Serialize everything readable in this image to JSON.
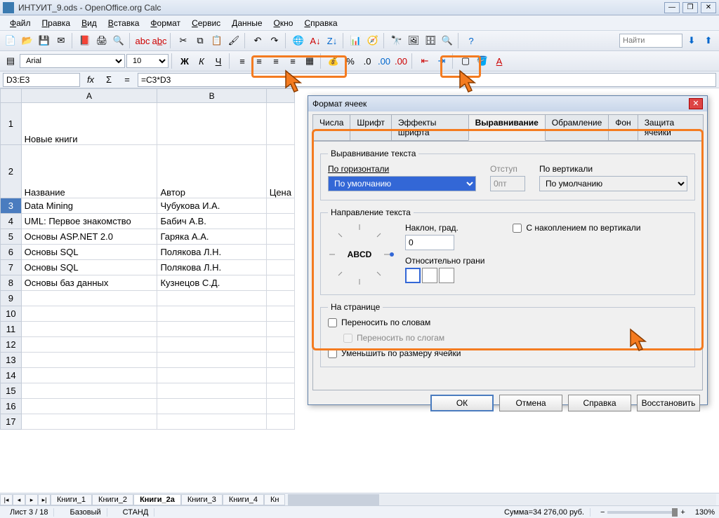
{
  "window": {
    "title": "ИНТУИТ_9.ods - OpenOffice.org Calc"
  },
  "menu": [
    "Файл",
    "Правка",
    "Вид",
    "Вставка",
    "Формат",
    "Сервис",
    "Данные",
    "Окно",
    "Справка"
  ],
  "toolbar2": {
    "font": "Arial",
    "size": "10",
    "search_placeholder": "Найти"
  },
  "formulabar": {
    "cellref": "D3:E3",
    "formula": "=C3*D3"
  },
  "columns": [
    "A",
    "B"
  ],
  "colC_hdr": "Цена",
  "rows": [
    {
      "n": "1",
      "a": "Новые книги",
      "b": "",
      "cls": "tall1"
    },
    {
      "n": "2",
      "a": "Название",
      "b": "Автор",
      "cls": "tall2"
    },
    {
      "n": "3",
      "a": "Data Mining",
      "b": "Чубукова И.А.",
      "sel": true
    },
    {
      "n": "4",
      "a": "UML: Первое знакомство",
      "b": "Бабич А.В."
    },
    {
      "n": "5",
      "a": "Основы ASP.NET 2.0",
      "b": "Гаряка А.А."
    },
    {
      "n": "6",
      "a": "Основы SQL",
      "b": "Полякова Л.Н."
    },
    {
      "n": "7",
      "a": "Основы SQL",
      "b": "Полякова Л.Н."
    },
    {
      "n": "8",
      "a": "Основы баз данных",
      "b": "Кузнецов С.Д."
    },
    {
      "n": "9",
      "a": "",
      "b": ""
    },
    {
      "n": "10",
      "a": "",
      "b": ""
    },
    {
      "n": "11",
      "a": "",
      "b": ""
    },
    {
      "n": "12",
      "a": "",
      "b": ""
    },
    {
      "n": "13",
      "a": "",
      "b": ""
    },
    {
      "n": "14",
      "a": "",
      "b": ""
    },
    {
      "n": "15",
      "a": "",
      "b": ""
    },
    {
      "n": "16",
      "a": "",
      "b": ""
    },
    {
      "n": "17",
      "a": "",
      "b": ""
    }
  ],
  "sheettabs": [
    "Книги_1",
    "Книги_2",
    "Книги_2а",
    "Книги_3",
    "Книги_4",
    "Кн"
  ],
  "active_tab": 2,
  "dialog": {
    "title": "Формат ячеек",
    "tabs": [
      "Числа",
      "Шрифт",
      "Эффекты шрифта",
      "Выравнивание",
      "Обрамление",
      "Фон",
      "Защита ячейки"
    ],
    "active_tab": 3,
    "align": {
      "group": "Выравнивание текста",
      "h_label": "По горизонтали",
      "h_value": "По умолчанию",
      "indent_label": "Отступ",
      "indent_value": "0пт",
      "v_label": "По вертикали",
      "v_value": "По умолчанию"
    },
    "direction": {
      "group": "Направление текста",
      "angle_label": "Наклон, град.",
      "angle_value": "0",
      "stack_label": "С накоплением по вертикали",
      "edge_label": "Относительно грани",
      "abcd": "ABCD"
    },
    "page": {
      "group": "На странице",
      "wrap": "Переносить по словам",
      "hyphen": "Переносить по слогам",
      "shrink": "Уменьшить по размеру ячейки"
    },
    "buttons": {
      "ok": "ОК",
      "cancel": "Отмена",
      "help": "Справка",
      "reset": "Восстановить"
    }
  },
  "status": {
    "sheet": "Лист 3 / 18",
    "style": "Базовый",
    "mode": "СТАНД",
    "sum": "Сумма=34 276,00 руб.",
    "zoom": "130%"
  }
}
